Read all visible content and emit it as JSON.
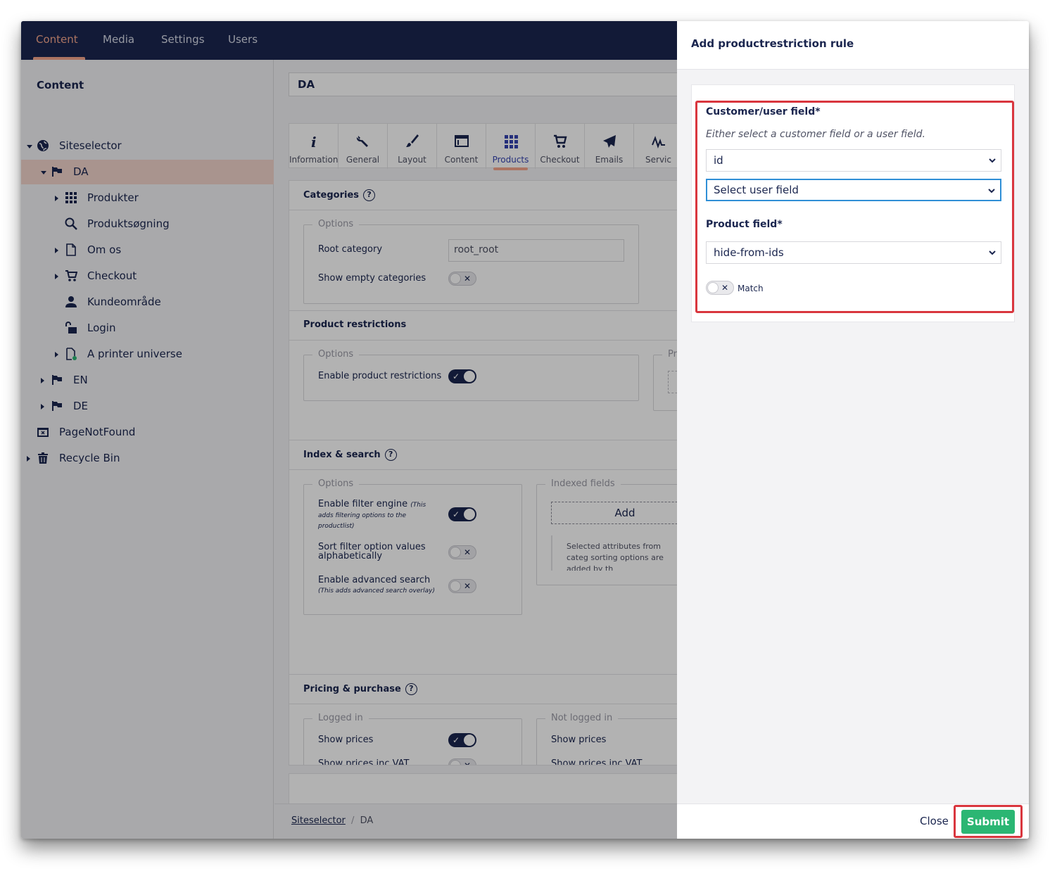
{
  "topnav": {
    "items": [
      "Content",
      "Media",
      "Settings",
      "Users"
    ],
    "active": "Content"
  },
  "sidebar": {
    "title": "Content",
    "tree": [
      {
        "label": "Siteselector",
        "icon": "globe-icon"
      },
      {
        "label": "DA",
        "icon": "flag-icon"
      },
      {
        "label": "Produkter",
        "icon": "grid-icon"
      },
      {
        "label": "Produktsøgning",
        "icon": "search-icon"
      },
      {
        "label": "Om os",
        "icon": "document-icon"
      },
      {
        "label": "Checkout",
        "icon": "cart-icon"
      },
      {
        "label": "Kundeområde",
        "icon": "user-icon"
      },
      {
        "label": "Login",
        "icon": "unlock-icon"
      },
      {
        "label": "A printer universe",
        "icon": "document-add-icon"
      },
      {
        "label": "EN",
        "icon": "flag-icon"
      },
      {
        "label": "DE",
        "icon": "flag-icon"
      },
      {
        "label": "PageNotFound",
        "icon": "calendar-x-icon"
      },
      {
        "label": "Recycle Bin",
        "icon": "trash-icon"
      }
    ]
  },
  "main": {
    "node_name": "DA",
    "tabs": [
      "Information",
      "General",
      "Layout",
      "Content",
      "Products",
      "Checkout",
      "Emails",
      "Servic"
    ],
    "active_tab": "Products",
    "categories": {
      "title": "Categories",
      "legend": "Options",
      "root_category_label": "Root category",
      "root_category_value": "root_root",
      "show_empty_label": "Show empty categories",
      "show_empty": false
    },
    "product_restrictions": {
      "title": "Product restrictions",
      "legend": "Options",
      "legend2": "Pr",
      "enable_label": "Enable product restrictions",
      "enabled": true
    },
    "index_search": {
      "title": "Index & search",
      "legend": "Options",
      "filter_engine_label": "Enable filter engine",
      "filter_engine_note": "(This adds filtering options to the productlist)",
      "filter_engine": true,
      "sort_label": "Sort filter option values alphabetically",
      "sort": false,
      "advanced_label": "Enable advanced search",
      "advanced_note": "(This adds advanced search overlay)",
      "advanced": false,
      "indexed_legend": "Indexed fields",
      "add_label": "Add",
      "indexed_note": "Selected attributes from categ sorting options are added by th"
    },
    "pricing": {
      "title": "Pricing & purchase",
      "logged_in_legend": "Logged in",
      "not_logged_in_legend": "Not logged in",
      "show_prices": "Show prices",
      "show_prices_vat": "Show prices inc VAT"
    },
    "breadcrumb": [
      "Siteselector",
      "DA"
    ]
  },
  "dialog": {
    "title": "Add productrestriction rule",
    "customer_field_label": "Customer/user field*",
    "customer_field_help": "Either select a customer field or a user field.",
    "customer_field_value": "id",
    "user_field_value": "Select user field",
    "product_field_label": "Product field*",
    "product_field_value": "hide-from-ids",
    "match_label": "Match",
    "match": false,
    "close_label": "Close",
    "submit_label": "Submit"
  },
  "colors": {
    "nav": "#1b264f",
    "accent": "#f5a78d",
    "submit": "#2bb673",
    "highlight": "#d9363e"
  }
}
